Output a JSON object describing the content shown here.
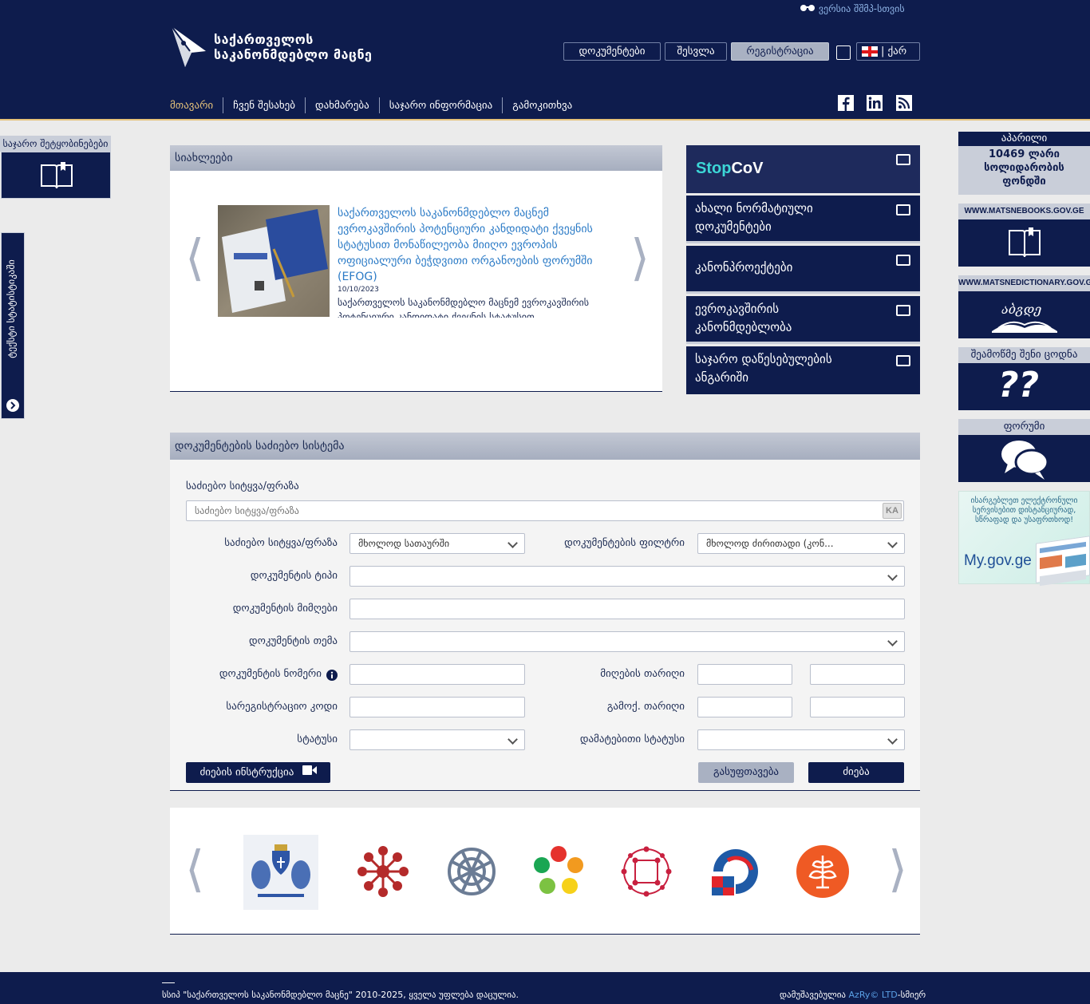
{
  "header": {
    "logo_line1": "საქართველოს",
    "logo_line2": "საკანონმდებლო მაცნე",
    "vision_link": "ვერსია შშმპ-სთვის",
    "buttons": {
      "documents": "დოკუმენტები",
      "login": "შესვლა",
      "register": "რეგისტრაცია"
    },
    "language": "| ქარ",
    "nav": [
      "მთავარი",
      "ჩვენ შესახებ",
      "დახმარება",
      "საჯარო ინფორმაცია",
      "გამოკითხვა"
    ],
    "nav_active_color": "#e6c27a"
  },
  "left": {
    "announcements_title": "საჯარო შეტყობინებები",
    "side_tab": "ტექსტი სტატისტიკაში"
  },
  "news": {
    "header": "სიახლეები",
    "item": {
      "title": "საქართველოს საკანონმდებლო მაცნემ ევროკავშირის პოტენციური კანდიდატი ქვეყნის სტატუსით მონაწილეობა მიიღო ევროპის ოფიციალური ბეჭდვითი ორგანოების ფორუმში (EFOG)",
      "date": "10/10/2023",
      "body": "საქართველოს საკანონმდებლო მაცნემ ევროკავშირის პოტენციური კანდიდატი ქვეყნის სტატუსით მონაწილეობა"
    }
  },
  "tiles": [
    {
      "label": "StopCoV",
      "brand_a": "Stop",
      "brand_b": "CoV"
    },
    {
      "line1": "ახალი ნორმატიული",
      "line2": "დოკუმენტები"
    },
    {
      "line1": "კანონპროექტები",
      "line2": ""
    },
    {
      "line1": "ევროკავშირის",
      "line2": "კანონმდებლობა"
    },
    {
      "line1": "საჯარო დაწესებულების",
      "line2": "ანგარიში"
    }
  ],
  "right": {
    "donation_title": "აპარილი",
    "donation_line1": "10469 ლარი",
    "donation_line2": "სოლიდარობის",
    "donation_line3": "ფონდში",
    "books_site": "WWW.MATSNEBOOKS.GOV.GE",
    "dictionary_site": "WWW.MATSNEDICTIONARY.GOV.GE",
    "quiz_title": "შეამოწმე შენი ცოდნა",
    "forum_title": "ფორუმი",
    "mygov_text": "ისარგებლეთ ელექტრონული სერვისებით დისტანციურად, სწრაფად და უსაფრთხოდ!",
    "mygov_logo": "My.gov.ge"
  },
  "search": {
    "header": "დოკუმენტების საძიებო სისტემა",
    "keyword_label": "საძიებო სიტყვა/ფრაზა",
    "keyword_placeholder": "საძიებო სიტყვა/ფრაზა",
    "kbd_badge": "KA",
    "scope_label": "საძიებო სიტყვა/ფრაზა",
    "scope_value": "მხოლოდ სათაურში",
    "filter_label": "დოკუმენტების ფილტრი",
    "filter_value": "მხოლოდ ძირითადი (კონ...",
    "type_label": "დოკუმენტის ტიპი",
    "issuer_label": "დოკუმენტის მიმღები",
    "topic_label": "დოკუმენტის თემა",
    "number_label": "დოკუმენტის ნომერი",
    "adopt_date_label": "მიღების თარიღი",
    "reg_code_label": "სარეგისტრაციო კოდი",
    "publish_date_label": "გამოქ. თარიღი",
    "status_label": "სტატუსი",
    "extra_status_label": "დამატებითი სტატუსი",
    "instruction_button": "ძიების ინსტრუქცია",
    "clear_button": "გასუფთავება",
    "search_button": "ძიება"
  },
  "footer": {
    "copyright": "სსიპ \"საქართველოს საკანონმდებლო მაცნე\" 2010-2025, ყველა უფლება დაცულია.",
    "made_by": "დამუშავებულია",
    "dev": "AzRy© LTD",
    "dev_suffix": "-სმიერ"
  }
}
